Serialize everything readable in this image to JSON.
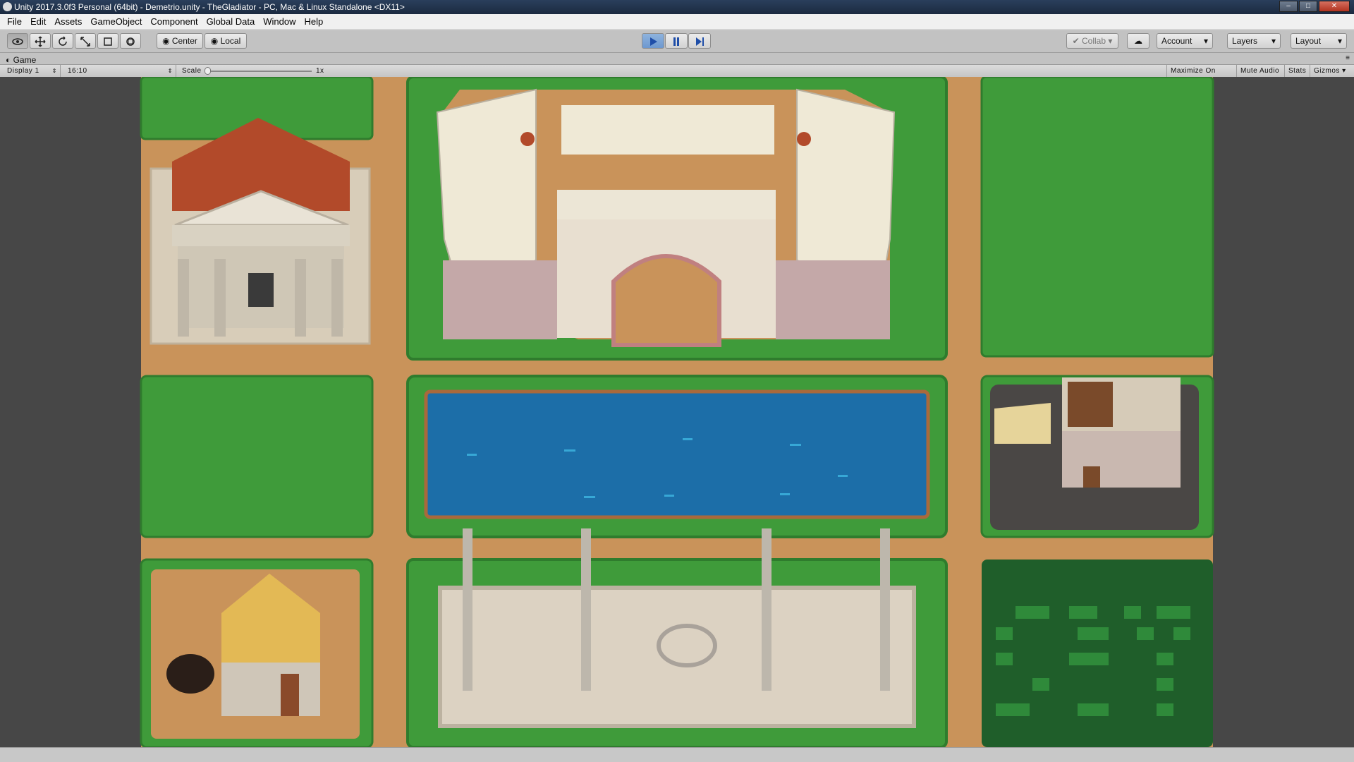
{
  "window": {
    "title": "Unity 2017.3.0f3 Personal (64bit) - Demetrio.unity - TheGladiator - PC, Mac & Linux Standalone <DX11>"
  },
  "menu": [
    "File",
    "Edit",
    "Assets",
    "GameObject",
    "Component",
    "Global Data",
    "Window",
    "Help"
  ],
  "toolbar": {
    "transform_tools": [
      "hand-tool",
      "move-tool",
      "rotate-tool",
      "scale-tool",
      "rect-tool",
      "transform-tool"
    ],
    "pivot_label": "Center",
    "space_label": "Local",
    "collab_label": "Collab",
    "account_label": "Account",
    "layers_label": "Layers",
    "layout_label": "Layout"
  },
  "game_view": {
    "tab_label": "Game",
    "display": "Display 1",
    "aspect": "16:10",
    "scale_label": "Scale",
    "scale_value": "1x",
    "maximize_label": "Maximize On Play",
    "mute_label": "Mute Audio",
    "stats_label": "Stats",
    "gizmos_label": "Gizmos"
  },
  "colors": {
    "grass": "#3f9b3a",
    "grass_dark": "#1f5e2a",
    "path": "#c9935a",
    "water": "#1c6ea8",
    "marble": "#e8dfd0",
    "roof_red": "#b24a2a",
    "thatch": "#e3b955"
  }
}
